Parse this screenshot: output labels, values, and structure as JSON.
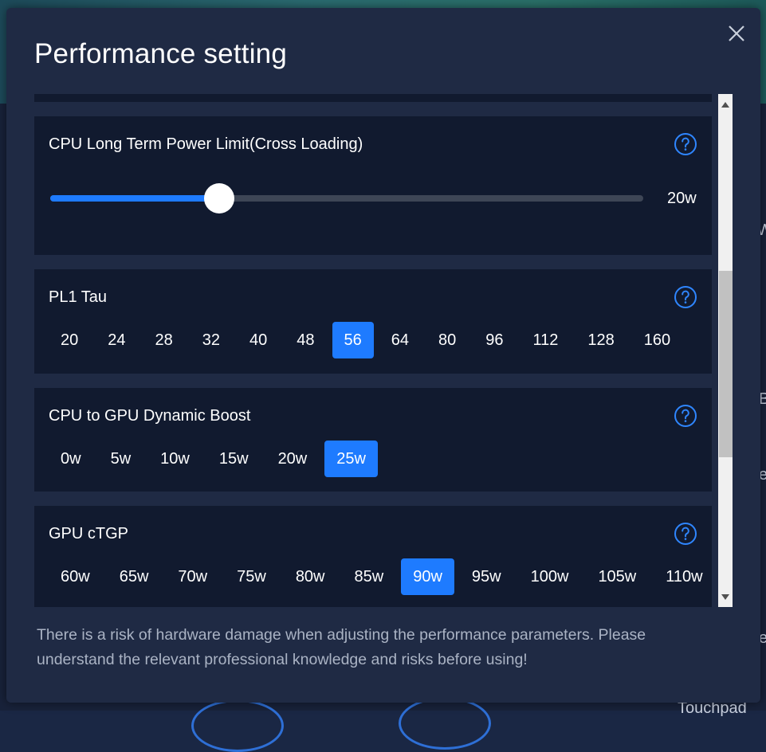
{
  "background": {
    "partial_text": [
      "W",
      "B",
      "e",
      "e",
      "Touchpad"
    ]
  },
  "modal": {
    "title": "Performance setting",
    "close_icon": "close-icon",
    "warning": "There is a risk of hardware damage when adjusting the performance parameters. Please understand the relevant professional knowledge and risks before using!"
  },
  "settings": {
    "cpu_long_term": {
      "label": "CPU Long Term Power Limit(Cross Loading)",
      "value_label": "20w",
      "slider_fraction": 0.285
    },
    "pl1_tau": {
      "label": "PL1 Tau",
      "options": [
        "20",
        "24",
        "28",
        "32",
        "40",
        "48",
        "56",
        "64",
        "80",
        "96",
        "112",
        "128",
        "160"
      ],
      "selected": "56"
    },
    "dynamic_boost": {
      "label": "CPU to GPU Dynamic Boost",
      "options": [
        "0w",
        "5w",
        "10w",
        "15w",
        "20w",
        "25w"
      ],
      "selected": "25w"
    },
    "gpu_ctgp": {
      "label": "GPU cTGP",
      "options": [
        "60w",
        "65w",
        "70w",
        "75w",
        "80w",
        "85w",
        "90w",
        "95w",
        "100w",
        "105w",
        "110w"
      ],
      "selected": "90w"
    }
  },
  "colors": {
    "accent": "#1e7bff",
    "panel": "#111a2f",
    "modal": "#1f2a44"
  }
}
